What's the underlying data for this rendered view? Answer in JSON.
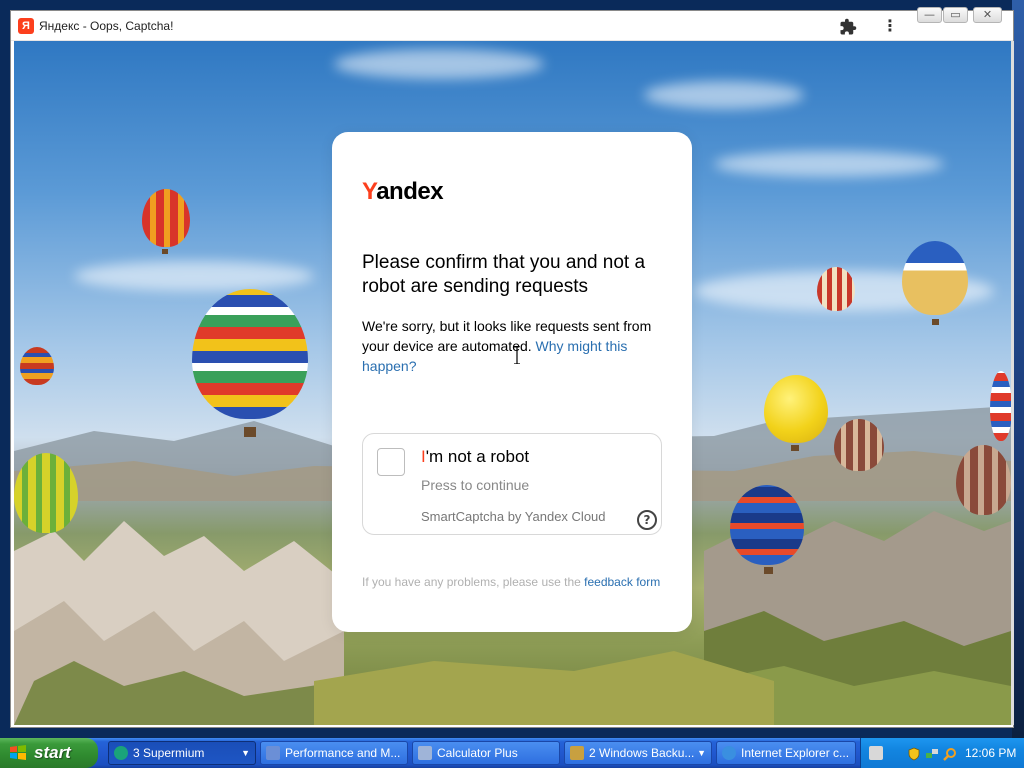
{
  "window": {
    "title": "Яндекс - Oops, Captcha!",
    "favicon_letter": "Я",
    "controls": {
      "minimize": "—",
      "maximize": "▭",
      "close": "✕"
    },
    "menu_glyph": "⋮"
  },
  "card": {
    "logo_y": "Y",
    "logo_rest": "andex",
    "heading": "Please confirm that you and not a robot are sending requests",
    "description": "We're sorry, but it looks like requests sent from your device are automated.",
    "why_link": "Why might this happen?",
    "checkbox": {
      "label_i": "I",
      "label_rest": "'m not a robot",
      "subtitle": "Press to continue",
      "provider": "SmartCaptcha by Yandex Cloud",
      "help_glyph": "?"
    },
    "footer_text": "If you have any problems, please use the",
    "footer_link": "feedback form"
  },
  "taskbar": {
    "start_label": "start",
    "items": [
      {
        "label": "3 Supermium",
        "count": "3",
        "name": "Supermium",
        "icon_color": "#1aa37a"
      },
      {
        "label": "Performance and M...",
        "icon_color": "#6b8fd6"
      },
      {
        "label": "Calculator Plus",
        "icon_color": "#9fb4d8"
      },
      {
        "label": "2 Windows Backu...",
        "count": "2",
        "name": "Windows Backu...",
        "icon_color": "#c8a040"
      },
      {
        "label": "Internet Explorer c...",
        "icon_color": "#3a8fe0"
      }
    ],
    "clock": "12:06 PM"
  },
  "colors": {
    "accent_red": "#fc3f1d",
    "link_blue": "#2a6fb0"
  }
}
